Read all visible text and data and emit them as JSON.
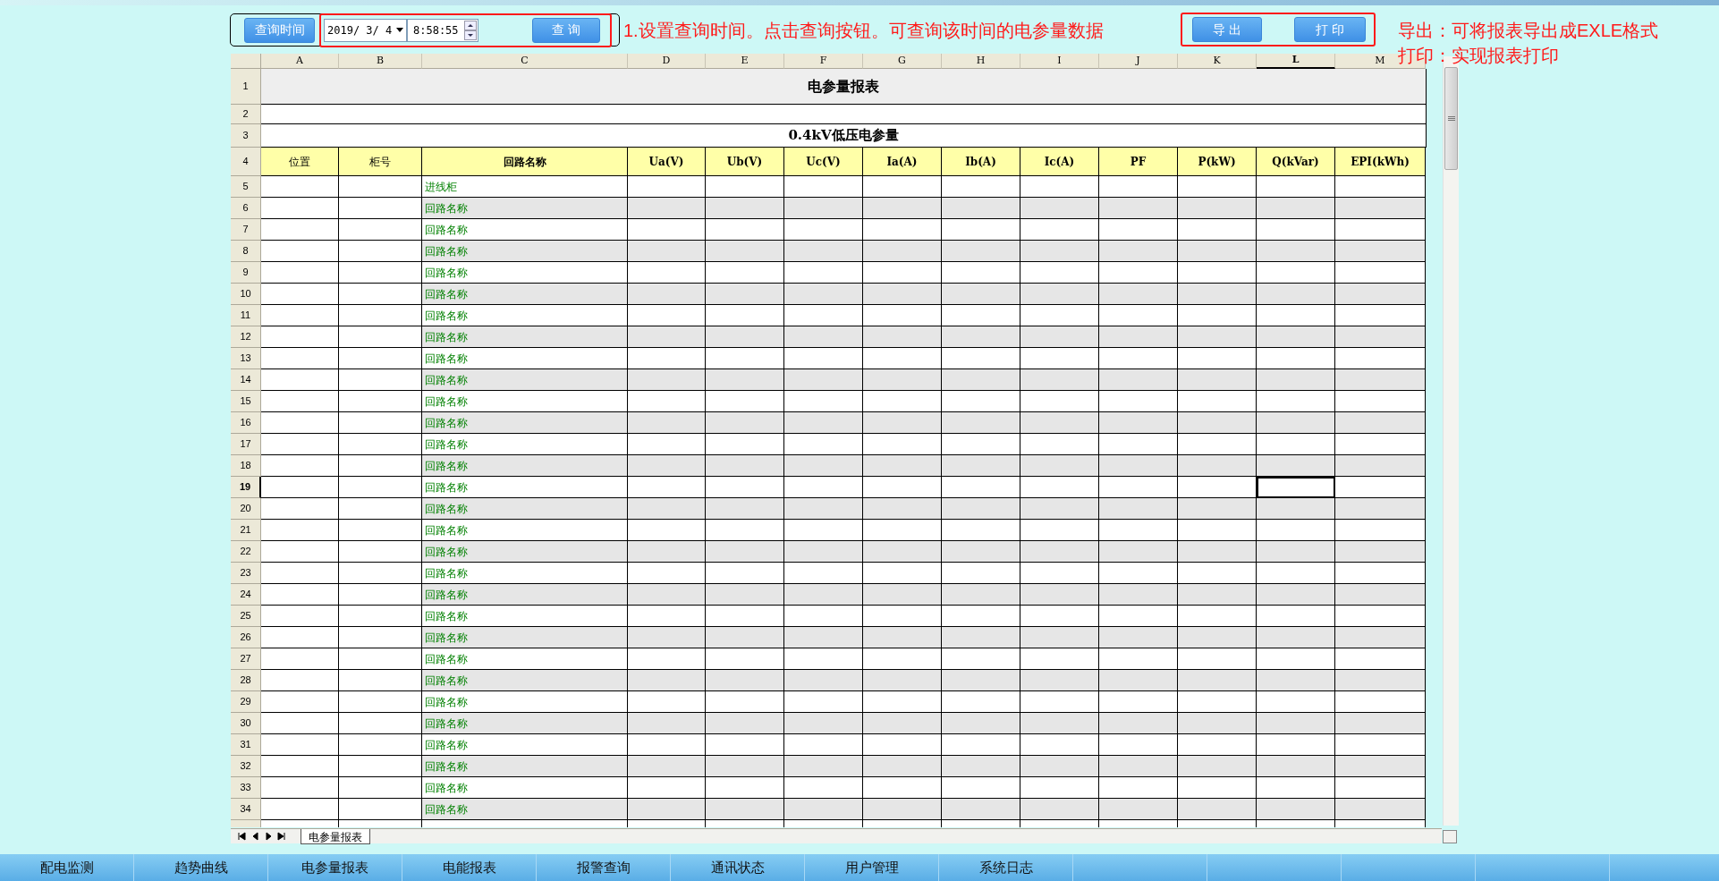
{
  "toolbar": {
    "time_button": "查询时间",
    "date": "2019/ 3/ 4",
    "time": "8:58:55",
    "query_button": "查 询",
    "export_button": "导 出",
    "print_button": "打 印"
  },
  "annotations": [
    "1.设置查询时间。点击查询按钮。可查询该时间的电参量数据",
    "导出：可将报表导出成EXLE格式",
    "打印：实现报表打印"
  ],
  "sheet": {
    "columns": [
      {
        "label": "A",
        "selected": false
      },
      {
        "label": "B",
        "selected": false
      },
      {
        "label": "C",
        "selected": false
      },
      {
        "label": "D",
        "selected": false
      },
      {
        "label": "E",
        "selected": false
      },
      {
        "label": "F",
        "selected": false
      },
      {
        "label": "G",
        "selected": false
      },
      {
        "label": "H",
        "selected": false
      },
      {
        "label": "I",
        "selected": false
      },
      {
        "label": "J",
        "selected": false
      },
      {
        "label": "K",
        "selected": false
      },
      {
        "label": "L",
        "selected": true
      },
      {
        "label": "M",
        "selected": false
      }
    ],
    "rows": [
      {
        "number": "1",
        "kind": "title",
        "selected": false,
        "text": "电参量报表"
      },
      {
        "number": "2",
        "kind": "blank",
        "selected": false
      },
      {
        "number": "3",
        "kind": "subtitle",
        "selected": false,
        "text": "0.4kV低压电参量"
      },
      {
        "number": "4",
        "kind": "header",
        "selected": false,
        "cells": [
          "位置",
          "柜号",
          "回路名称",
          "Ua(V)",
          "Ub(V)",
          "Uc(V)",
          "Ia(A)",
          "Ib(A)",
          "Ic(A)",
          "PF",
          "P(kW)",
          "Q(kVar)",
          "EPI(kWh)"
        ]
      },
      {
        "number": "5",
        "kind": "data",
        "selected": false,
        "shaded": false,
        "name": "进线柜"
      },
      {
        "number": "6",
        "kind": "data",
        "selected": false,
        "shaded": true,
        "name": "回路名称"
      },
      {
        "number": "7",
        "kind": "data",
        "selected": false,
        "shaded": false,
        "name": "回路名称"
      },
      {
        "number": "8",
        "kind": "data",
        "selected": false,
        "shaded": true,
        "name": "回路名称"
      },
      {
        "number": "9",
        "kind": "data",
        "selected": false,
        "shaded": false,
        "name": "回路名称"
      },
      {
        "number": "10",
        "kind": "data",
        "selected": false,
        "shaded": true,
        "name": "回路名称"
      },
      {
        "number": "11",
        "kind": "data",
        "selected": false,
        "shaded": false,
        "name": "回路名称"
      },
      {
        "number": "12",
        "kind": "data",
        "selected": false,
        "shaded": true,
        "name": "回路名称"
      },
      {
        "number": "13",
        "kind": "data",
        "selected": false,
        "shaded": false,
        "name": "回路名称"
      },
      {
        "number": "14",
        "kind": "data",
        "selected": false,
        "shaded": true,
        "name": "回路名称"
      },
      {
        "number": "15",
        "kind": "data",
        "selected": false,
        "shaded": false,
        "name": "回路名称"
      },
      {
        "number": "16",
        "kind": "data",
        "selected": false,
        "shaded": true,
        "name": "回路名称"
      },
      {
        "number": "17",
        "kind": "data",
        "selected": false,
        "shaded": false,
        "name": "回路名称"
      },
      {
        "number": "18",
        "kind": "data",
        "selected": false,
        "shaded": true,
        "name": "回路名称"
      },
      {
        "number": "19",
        "kind": "data",
        "selected": true,
        "shaded": false,
        "name": "回路名称"
      },
      {
        "number": "20",
        "kind": "data",
        "selected": false,
        "shaded": true,
        "name": "回路名称"
      },
      {
        "number": "21",
        "kind": "data",
        "selected": false,
        "shaded": false,
        "name": "回路名称"
      },
      {
        "number": "22",
        "kind": "data",
        "selected": false,
        "shaded": true,
        "name": "回路名称"
      },
      {
        "number": "23",
        "kind": "data",
        "selected": false,
        "shaded": false,
        "name": "回路名称"
      },
      {
        "number": "24",
        "kind": "data",
        "selected": false,
        "shaded": true,
        "name": "回路名称"
      },
      {
        "number": "25",
        "kind": "data",
        "selected": false,
        "shaded": false,
        "name": "回路名称"
      },
      {
        "number": "26",
        "kind": "data",
        "selected": false,
        "shaded": true,
        "name": "回路名称"
      },
      {
        "number": "27",
        "kind": "data",
        "selected": false,
        "shaded": false,
        "name": "回路名称"
      },
      {
        "number": "28",
        "kind": "data",
        "selected": false,
        "shaded": true,
        "name": "回路名称"
      },
      {
        "number": "29",
        "kind": "data",
        "selected": false,
        "shaded": false,
        "name": "回路名称"
      },
      {
        "number": "30",
        "kind": "data",
        "selected": false,
        "shaded": true,
        "name": "回路名称"
      },
      {
        "number": "31",
        "kind": "data",
        "selected": false,
        "shaded": false,
        "name": "回路名称"
      },
      {
        "number": "32",
        "kind": "data",
        "selected": false,
        "shaded": true,
        "name": "回路名称"
      },
      {
        "number": "33",
        "kind": "data",
        "selected": false,
        "shaded": false,
        "name": "回路名称"
      },
      {
        "number": "34",
        "kind": "data",
        "selected": false,
        "shaded": true,
        "name": "回路名称"
      }
    ],
    "sheet_tabs": [
      {
        "label": "电参量报表",
        "selected": true
      }
    ]
  },
  "nav": [
    "配电监测",
    "趋势曲线",
    "电参量报表",
    "电能报表",
    "报警查询",
    "通讯状态",
    "用户管理",
    "系统日志"
  ]
}
